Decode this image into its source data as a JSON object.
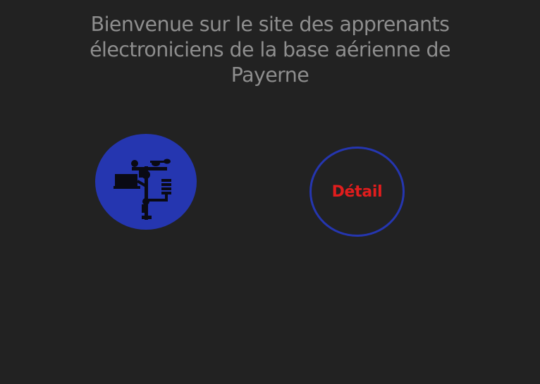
{
  "page": {
    "title": "Bienvenue sur le site des apprenants électroniciens de la base aérienne de Payerne"
  },
  "logo": {
    "icon": "weather-station-icon",
    "background_color": "#2536b0",
    "figure_color": "#0a0a14"
  },
  "detail_button": {
    "label": "Détail",
    "label_color": "#e11d1d",
    "ring_color": "#2536b0"
  },
  "colors": {
    "background": "#222222",
    "title_text": "#8e8e8e"
  }
}
